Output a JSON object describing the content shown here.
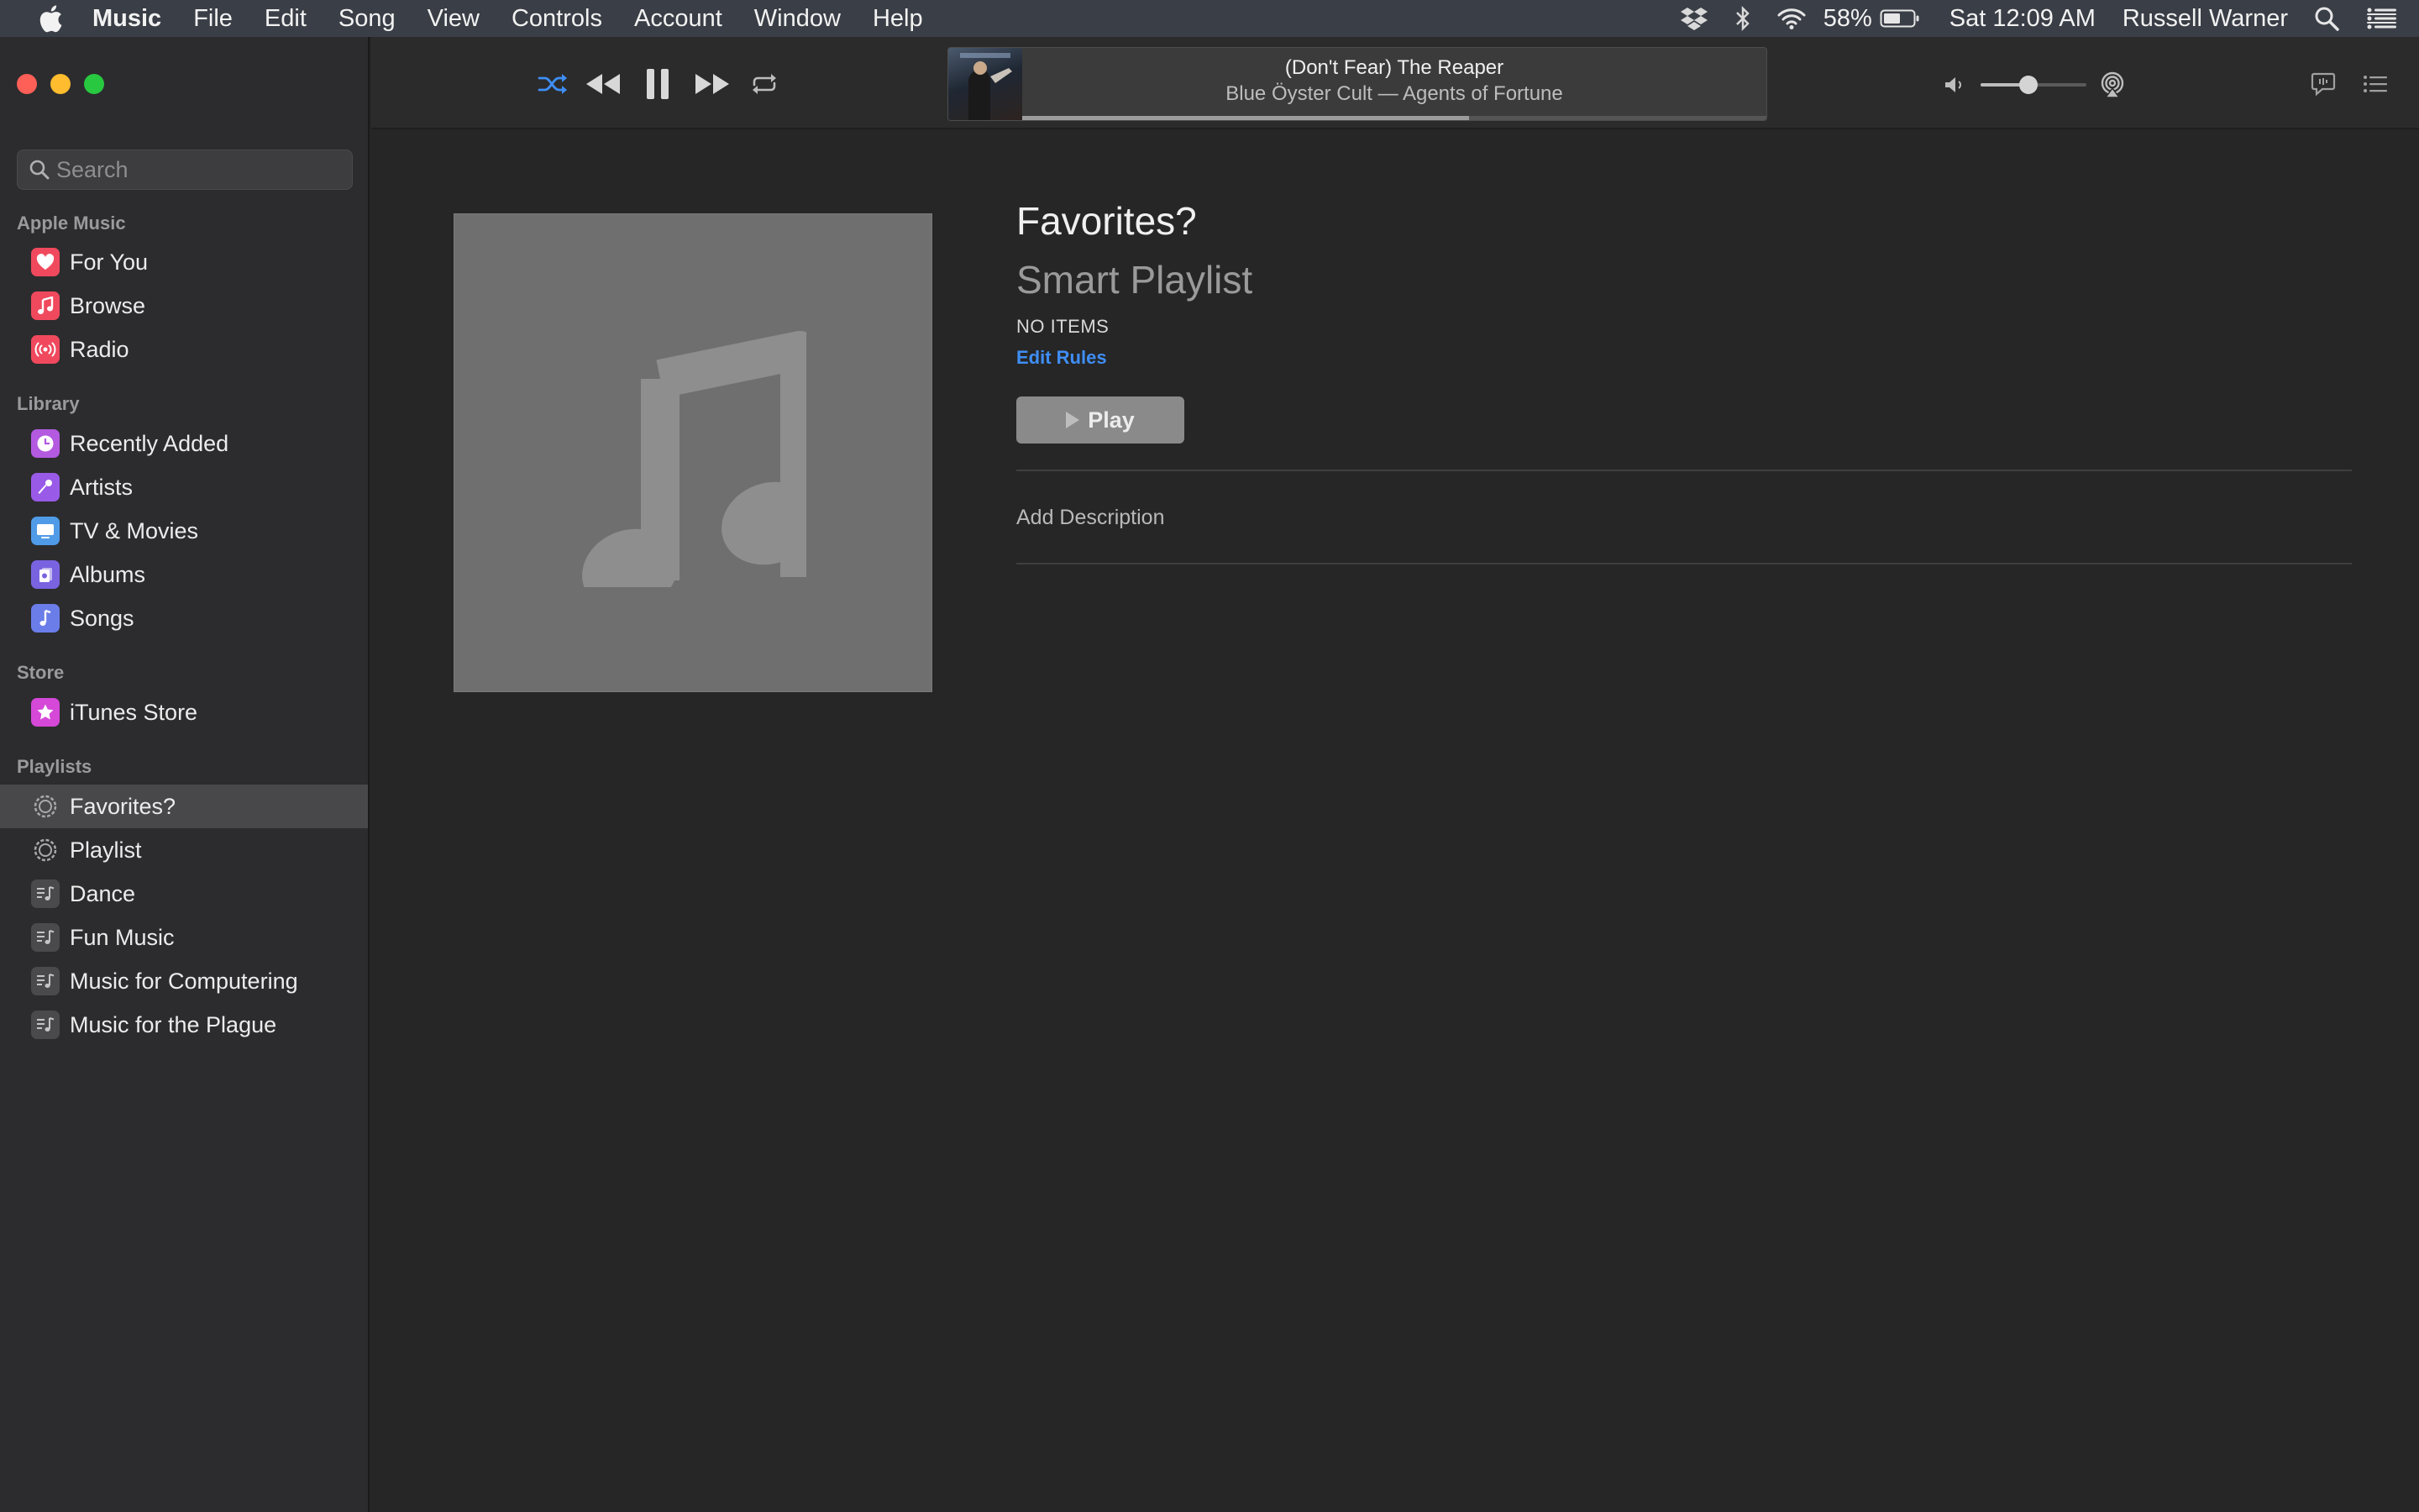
{
  "menubar": {
    "app_name": "Music",
    "items": [
      "File",
      "Edit",
      "Song",
      "View",
      "Controls",
      "Account",
      "Window",
      "Help"
    ],
    "battery": "58%",
    "clock": "Sat 12:09 AM",
    "user": "Russell Warner"
  },
  "sidebar": {
    "search_placeholder": "Search",
    "sections": {
      "apple_music": "Apple Music",
      "library": "Library",
      "store": "Store",
      "playlists": "Playlists"
    },
    "apple_music_items": [
      {
        "label": "For You",
        "icon": "heart-icon",
        "color": "#f0495d"
      },
      {
        "label": "Browse",
        "icon": "music-note-icon",
        "color": "#f0495d"
      },
      {
        "label": "Radio",
        "icon": "radio-waves-icon",
        "color": "#f0495d"
      }
    ],
    "library_items": [
      {
        "label": "Recently Added",
        "icon": "clock-icon",
        "color": "#b35ae0"
      },
      {
        "label": "Artists",
        "icon": "microphone-icon",
        "color": "#9a5ae8"
      },
      {
        "label": "TV & Movies",
        "icon": "tv-icon",
        "color": "#4f9be8"
      },
      {
        "label": "Albums",
        "icon": "album-stack-icon",
        "color": "#7a63e0"
      },
      {
        "label": "Songs",
        "icon": "music-note-icon",
        "color": "#6a7de8"
      }
    ],
    "store_items": [
      {
        "label": "iTunes Store",
        "icon": "star-icon",
        "color": "#d548d8"
      }
    ],
    "playlist_items": [
      {
        "label": "Favorites?",
        "icon": "smart-playlist-gear-icon",
        "selected": true
      },
      {
        "label": "Playlist",
        "icon": "smart-playlist-gear-icon",
        "selected": false
      },
      {
        "label": "Dance",
        "icon": "playlist-icon",
        "selected": false
      },
      {
        "label": "Fun Music",
        "icon": "playlist-icon",
        "selected": false
      },
      {
        "label": "Music for Computering",
        "icon": "playlist-icon",
        "selected": false
      },
      {
        "label": "Music for the Plague",
        "icon": "playlist-icon",
        "selected": false
      }
    ]
  },
  "player": {
    "shuffle_active": true,
    "accent": "#3f8ef5",
    "now_playing": {
      "title": "(Don't Fear) The Reaper",
      "subtitle": "Blue Öyster Cult — Agents of Fortune",
      "progress": 0.6
    },
    "volume": 0.45
  },
  "playlist": {
    "name": "Favorites?",
    "type": "Smart Playlist",
    "count": "NO ITEMS",
    "edit_rules": "Edit Rules",
    "play": "Play",
    "add_description": "Add Description"
  }
}
